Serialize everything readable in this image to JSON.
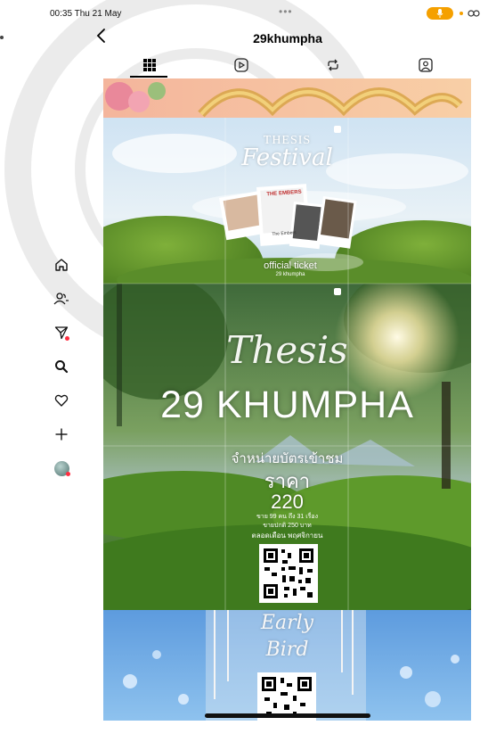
{
  "status_bar": {
    "time": "00:35  Thu 21 May",
    "dots": "•••"
  },
  "header": {
    "username": "29khumpha"
  },
  "tabs": [
    {
      "name": "posts",
      "icon": "grid-icon",
      "active": true
    },
    {
      "name": "reels",
      "icon": "play-icon",
      "active": false
    },
    {
      "name": "reposts",
      "icon": "repost-icon",
      "active": false
    },
    {
      "name": "tagged",
      "icon": "tagged-person-icon",
      "active": false
    }
  ],
  "sidenav": [
    {
      "name": "home",
      "icon": "home-icon",
      "badge": false
    },
    {
      "name": "friends",
      "icon": "people-icon",
      "badge": false
    },
    {
      "name": "messages",
      "icon": "send-icon",
      "badge": true
    },
    {
      "name": "search",
      "icon": "search-icon",
      "badge": false
    },
    {
      "name": "notifications",
      "icon": "heart-icon",
      "badge": false
    },
    {
      "name": "create",
      "icon": "plus-icon",
      "badge": false
    },
    {
      "name": "profile",
      "icon": "avatar",
      "badge": true
    }
  ],
  "posts": {
    "thesis_festival": {
      "title_top": "THESIS",
      "title_bottom": "Festival",
      "card_1": "THE EMBERS",
      "card_caption": "The Embers",
      "ticket_line_1": "official ticket",
      "ticket_line_2": "29 khumpha"
    },
    "main_poster": {
      "script_title": "Thesis",
      "big_title": "29 KHUMPHA",
      "sale_label": "จำหน่ายบัตรเข้าชม",
      "price_word": "ราคา",
      "price": "220",
      "detail_1": "ขาย 99 คน ถึง 31 เรื่อง",
      "detail_2": "ขายปกติ 250 บาท",
      "detail_3": "ตลอดเดือน พฤศจิกายน"
    },
    "early_bird": {
      "line_1": "Early",
      "line_2": "Bird"
    }
  },
  "colors": {
    "accent_orange": "#f5a000",
    "badge_red": "#ff2d40",
    "top_banner": "#f6c49a"
  }
}
